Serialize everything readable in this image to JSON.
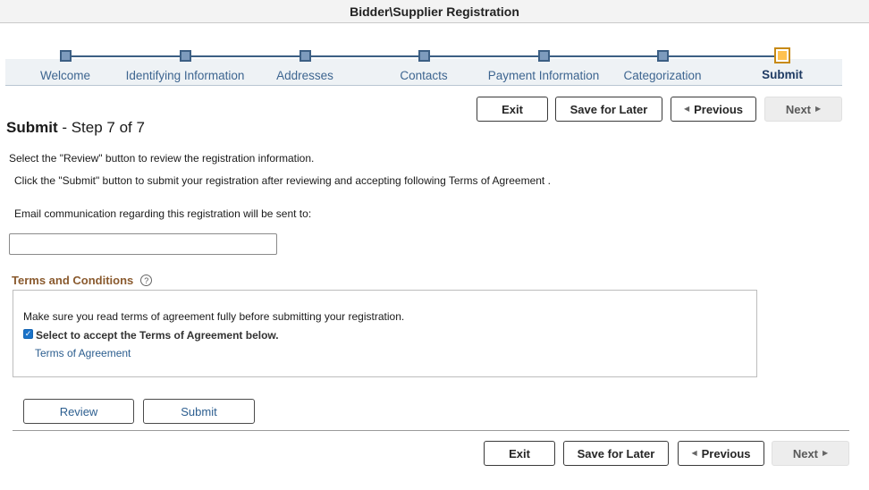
{
  "header": {
    "title": "Bidder\\Supplier Registration"
  },
  "train": {
    "steps": [
      {
        "label": "Welcome"
      },
      {
        "label": "Identifying Information"
      },
      {
        "label": "Addresses"
      },
      {
        "label": "Contacts"
      },
      {
        "label": "Payment Information"
      },
      {
        "label": "Categorization"
      },
      {
        "label": "Submit"
      }
    ],
    "current_index": 6
  },
  "toolbar": {
    "exit_label": "Exit",
    "save_later_label": "Save for Later",
    "previous_label": "Previous",
    "next_label": "Next"
  },
  "page": {
    "title_bold": "Submit",
    "title_rest": " - Step 7 of 7",
    "review_instruction": "Select the \"Review\" button to review the registration information.",
    "submit_instruction": "Click the \"Submit\" button to submit your registration after reviewing and accepting following Terms of Agreement .",
    "email_prompt": "Email communication regarding this registration will be sent to:",
    "email_value": ""
  },
  "terms": {
    "title": "Terms and Conditions",
    "help_symbol": "?",
    "notice": "Make sure you read terms of agreement fully before submitting your registration.",
    "accept_label": "Select to accept the Terms of Agreement below.",
    "accept_checked": true,
    "link_label": "Terms of Agreement"
  },
  "actions": {
    "review_label": "Review",
    "submit_label": "Submit"
  },
  "colors": {
    "accent_blue": "#3d6590",
    "section_brown": "#8a5a2e",
    "current_step": "#ffc14f"
  }
}
